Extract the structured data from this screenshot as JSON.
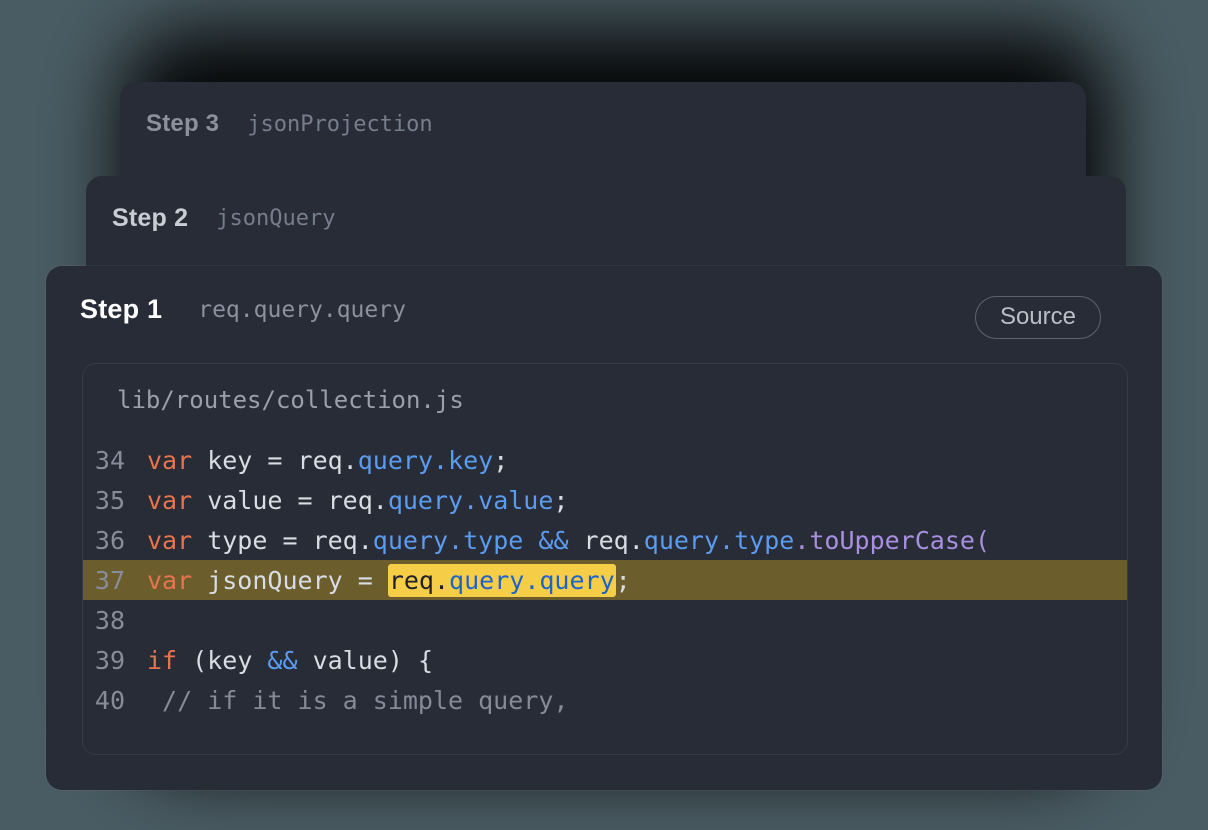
{
  "theme": {
    "canvas_bg": "#4a5c63",
    "card_bg": "#272c36",
    "accent_highlight": "#f5cd46",
    "row_highlight": "#6b5d2c",
    "keyword_color": "#e8744f",
    "property_color": "#5b9bf0",
    "function_color": "#a98fe0",
    "comment_color": "#848b97"
  },
  "cards": {
    "step3": {
      "step_label": "Step 3",
      "expression": "jsonProjection"
    },
    "step2": {
      "step_label": "Step 2",
      "expression": "jsonQuery"
    },
    "step1": {
      "step_label": "Step 1",
      "expression": "req.query.query",
      "source_button": "Source",
      "file_name": "lib/routes/collection.js",
      "lines": [
        {
          "number": "34",
          "highlighted": false
        },
        {
          "number": "35",
          "highlighted": false
        },
        {
          "number": "36",
          "highlighted": false
        },
        {
          "number": "37",
          "highlighted": true
        },
        {
          "number": "38",
          "highlighted": false
        },
        {
          "number": "39",
          "highlighted": false
        },
        {
          "number": "40",
          "highlighted": false
        }
      ],
      "code": {
        "l34": {
          "kw": "var",
          "rest": " key = req.",
          "p1": "query",
          "dot": ".",
          "p2": "key",
          "end": ";"
        },
        "l35": {
          "kw": "var",
          "rest": " value = req.",
          "p1": "query",
          "dot": ".",
          "p2": "value",
          "end": ";"
        },
        "l36": {
          "kw": "var",
          "rest": " type = req.",
          "p1": "query",
          "dot": ".",
          "p2": "type",
          "mid": " ",
          "op": "&&",
          "mid2": " req.",
          "p3": "query",
          "dot2": ".",
          "p4": "type",
          "dot3": ".",
          "fn": "toUpperCase",
          "end": "("
        },
        "l37": {
          "kw": "var",
          "rest": " jsonQuery = ",
          "mark_a": "req.",
          "mark_b": "query",
          "mark_c": ".",
          "mark_d": "query",
          "end": ";"
        },
        "l38": {
          "text": ""
        },
        "l39": {
          "kw": "if",
          "rest": " (key ",
          "op": "&&",
          "rest2": " value) {"
        },
        "l40": {
          "comment": " // if it is a simple query,"
        }
      }
    }
  }
}
